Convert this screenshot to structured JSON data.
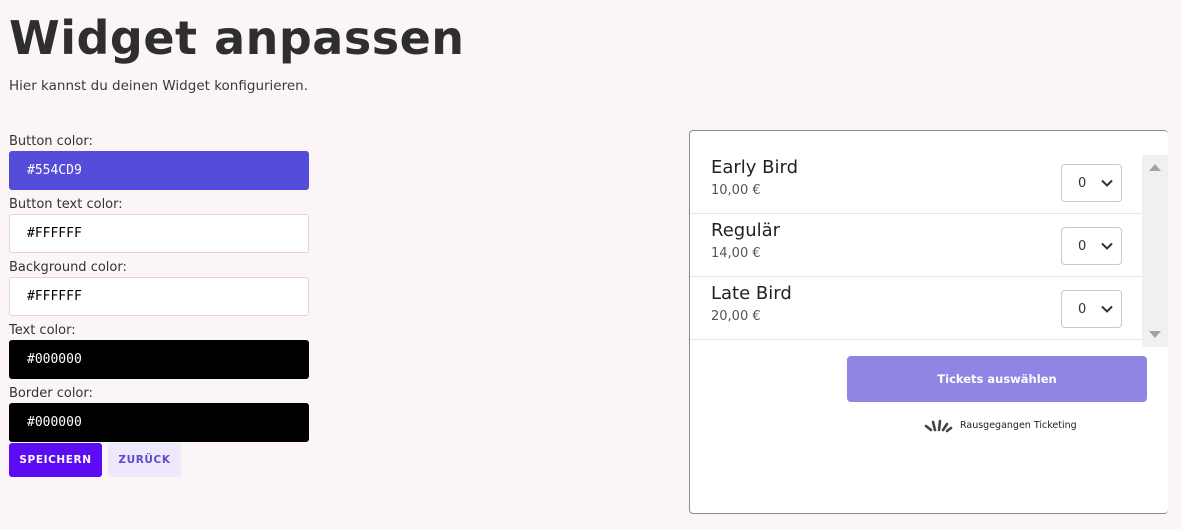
{
  "header": {
    "title": "Widget anpassen",
    "subtitle": "Hier kannst du deinen Widget konfigurieren."
  },
  "form": {
    "fields": [
      {
        "label": "Button color:",
        "value": "#554CD9",
        "bg": "#554CD9",
        "fg": "#FFFFFF"
      },
      {
        "label": "Button text color:",
        "value": "#FFFFFF",
        "bg": "#FFFFFF",
        "fg": "#000000"
      },
      {
        "label": "Background color:",
        "value": "#FFFFFF",
        "bg": "#FFFFFF",
        "fg": "#000000"
      },
      {
        "label": "Text color:",
        "value": "#000000",
        "bg": "#000000",
        "fg": "#FFFFFF"
      },
      {
        "label": "Border color:",
        "value": "#000000",
        "bg": "#000000",
        "fg": "#FFFFFF"
      }
    ],
    "save_label": "SPEICHERN",
    "back_label": "ZURÜCK"
  },
  "preview": {
    "tickets": [
      {
        "name": "Early Bird",
        "price": "10,00 €",
        "qty": "0"
      },
      {
        "name": "Regulär",
        "price": "14,00 €",
        "qty": "0"
      },
      {
        "name": "Late Bird",
        "price": "20,00 €",
        "qty": "0"
      }
    ],
    "select_button_label": "Tickets auswählen",
    "brand_icon": "rausgegangen-logo-icon",
    "brand_text": "Rausgegangen Ticketing"
  },
  "colors": {
    "page_bg": "#FCF5F7",
    "save_button": "#5B0CF3",
    "back_button_bg": "#EFE8FB",
    "select_button": "#8F85E5"
  }
}
